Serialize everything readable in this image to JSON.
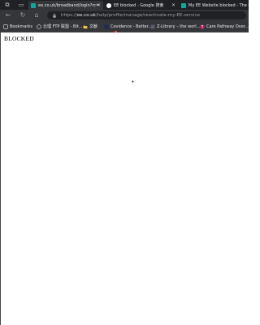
{
  "tabs": [
    {
      "title": "ee.co.uk/broadband/login?rc=",
      "favicon": "ee-icon",
      "color": "#14a69b",
      "active": true
    },
    {
      "title": "EE blocked - Google 搜索",
      "favicon": "google-icon",
      "color": "#ffffff",
      "active": false
    },
    {
      "title": "My EE Website blocked - The C",
      "favicon": "ee-icon",
      "color": "#14a69b",
      "active": false
    }
  ],
  "address": {
    "prefix": "https://",
    "domain": "ee.co.uk",
    "path": "/help/profile/manage/reactivate-my-EE-service"
  },
  "bookmarks": [
    {
      "label": "Bookmarks",
      "icon": "bookmark-icon"
    },
    {
      "label": "北理 FTP 联盟 - Bit...",
      "icon": "link-icon"
    },
    {
      "label": "文献",
      "icon": "folder-icon"
    },
    {
      "label": "Covidence - Better...",
      "icon": "covidence-icon"
    },
    {
      "label": "Z-Library – the worl...",
      "icon": "zlib-icon"
    },
    {
      "label": "Care Pathway Over...",
      "icon": "t-icon"
    }
  ],
  "page": {
    "text": "BLOCKED"
  }
}
